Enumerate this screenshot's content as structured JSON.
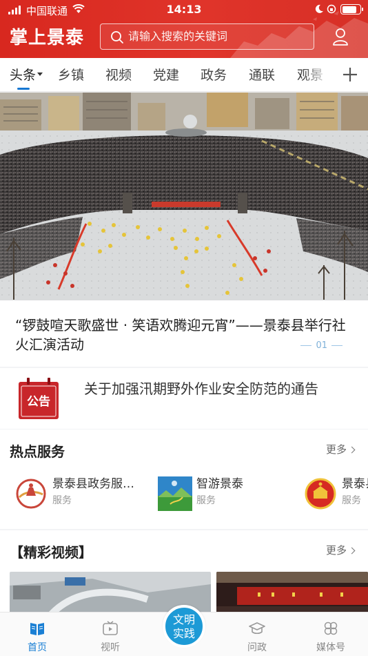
{
  "status_bar": {
    "carrier": "中国联通",
    "time": "14:13",
    "battery_level": 0.85
  },
  "header": {
    "app_title": "掌上景泰",
    "search_placeholder": "请输入搜索的关键词",
    "brand_color": "#d8281f"
  },
  "tabs": [
    {
      "label": "头条",
      "active": true
    },
    {
      "label": "乡镇"
    },
    {
      "label": "视频"
    },
    {
      "label": "党建"
    },
    {
      "label": "政务"
    },
    {
      "label": "通联"
    },
    {
      "label": "观景"
    }
  ],
  "banner": {
    "title": "“锣鼓喧天歌盛世 · 笑语欢腾迎元宵”——景泰县举行社火汇演活动",
    "page": "01"
  },
  "notice": {
    "icon_label": "公告",
    "text": "关于加强汛期野外作业安全防范的通告"
  },
  "hot_services": {
    "heading": "热点服务",
    "more": "更多",
    "items": [
      {
        "name": "景泰县政务服…",
        "sub": "服务",
        "icon": "government-service-logo"
      },
      {
        "name": "智游景泰",
        "sub": "服务",
        "icon": "smart-tour-landscape"
      },
      {
        "name": "景泰县",
        "sub": "服务",
        "icon": "national-emblem"
      }
    ]
  },
  "videos": {
    "heading": "【精彩视频】",
    "more": "更多"
  },
  "bottom_nav": {
    "items": [
      {
        "label": "首页",
        "icon": "home-book-icon",
        "active": true
      },
      {
        "label": "视听",
        "icon": "tv-play-icon"
      },
      {
        "label": "问政",
        "icon": "graduation-cap-icon"
      },
      {
        "label": "媒体号",
        "icon": "clover-icon"
      }
    ],
    "center": {
      "line1": "文明",
      "line2": "实践"
    }
  },
  "accent_color": "#1d9ad6"
}
